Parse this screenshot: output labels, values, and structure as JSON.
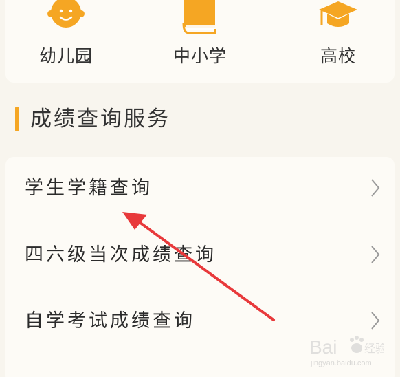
{
  "categories": [
    {
      "label": "幼儿园",
      "icon": "baby-face-icon"
    },
    {
      "label": "中小学",
      "icon": "book-icon"
    },
    {
      "label": "高校",
      "icon": "graduation-cap-icon"
    }
  ],
  "section": {
    "title": "成绩查询服务"
  },
  "services": [
    {
      "label": "学生学籍查询"
    },
    {
      "label": "四六级当次成绩查询"
    },
    {
      "label": "自学考试成绩查询"
    }
  ],
  "colors": {
    "accent": "#f5a623",
    "text": "#333333",
    "arrow": "#e8393b"
  },
  "watermark": {
    "logo_text": "Bai",
    "logo_text_2": "经验",
    "url": "jingyan.baidu.com"
  }
}
